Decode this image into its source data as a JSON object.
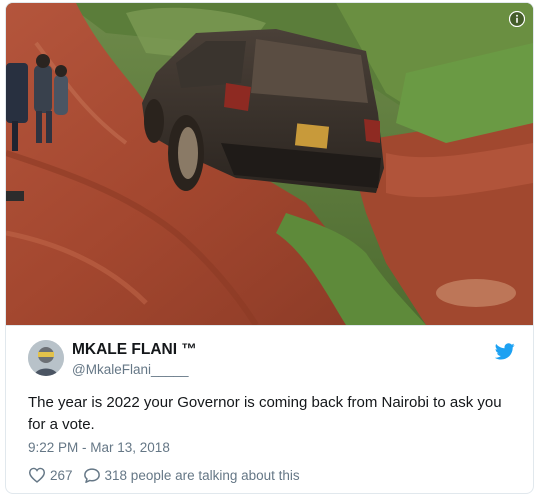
{
  "tweet": {
    "display_name": "MKALE FLANI ™",
    "handle": "@MkaleFlani_____",
    "text": "The year is 2022 your Governor is coming back from Nairobi to ask you for a vote.",
    "timestamp": "9:22 PM - Mar 13, 2018",
    "likes": "267",
    "conversation": "318 people are talking about this"
  },
  "media": {
    "description_icon": "info-icon",
    "subject": "muddy-road-suv-photo"
  },
  "icons": {
    "brand": "twitter-bird-icon",
    "like": "heart-icon",
    "reply": "speech-bubble-icon"
  },
  "colors": {
    "brand": "#1da1f2",
    "text_primary": "#14171a",
    "text_secondary": "#657786",
    "border": "#e1e8ed"
  }
}
